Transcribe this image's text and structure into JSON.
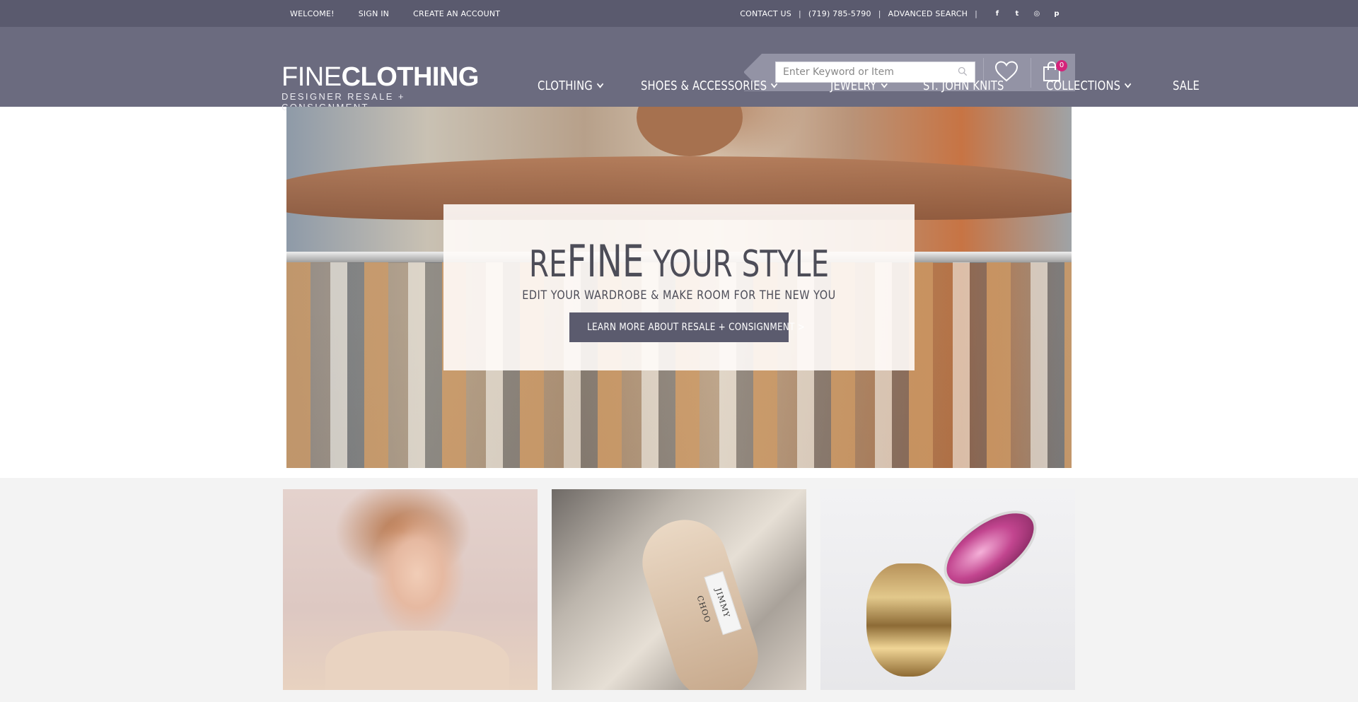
{
  "topbar": {
    "welcome": "WELCOME!",
    "sign_in": "SIGN IN",
    "create_account": "CREATE AN ACCOUNT",
    "contact_us": "CONTACT US",
    "phone": "(719) 785-5790",
    "advanced_search": "ADVANCED SEARCH",
    "separator": "|",
    "social": [
      "facebook-icon",
      "twitter-icon",
      "instagram-icon",
      "pinterest-icon"
    ],
    "social_glyphs": [
      "f",
      "t",
      "◎",
      "p"
    ]
  },
  "logo": {
    "fine": "FINE",
    "clothing": "CLOTHING",
    "tagline": "DESIGNER RESALE + CONSIGNMENT"
  },
  "search": {
    "placeholder": "Enter Keyword or Item"
  },
  "cart": {
    "count": "0"
  },
  "nav": {
    "items": [
      {
        "label": "CLOTHING",
        "dropdown": true
      },
      {
        "label": "SHOES & ACCESSORIES",
        "dropdown": true
      },
      {
        "label": "JEWELRY",
        "dropdown": true
      },
      {
        "label": "ST. JOHN KNITS",
        "dropdown": false
      },
      {
        "label": "COLLECTIONS",
        "dropdown": true
      },
      {
        "label": "SALE",
        "dropdown": false
      }
    ]
  },
  "hero": {
    "title_pre": "RE",
    "title_big": "FINE",
    "title_post": " YOUR STYLE",
    "subtitle": "EDIT YOUR WARDROBE & MAKE ROOM FOR THE NEW YOU",
    "cta": "LEARN MORE ABOUT RESALE + CONSIGNMENT >"
  },
  "tiles": {
    "shoe_label": "JIMMY CHOO"
  },
  "colors": {
    "topbar": "#5a5a6e",
    "header": "#6b6b7f",
    "accent": "#d4237a",
    "cta": "#5b5b6e"
  }
}
